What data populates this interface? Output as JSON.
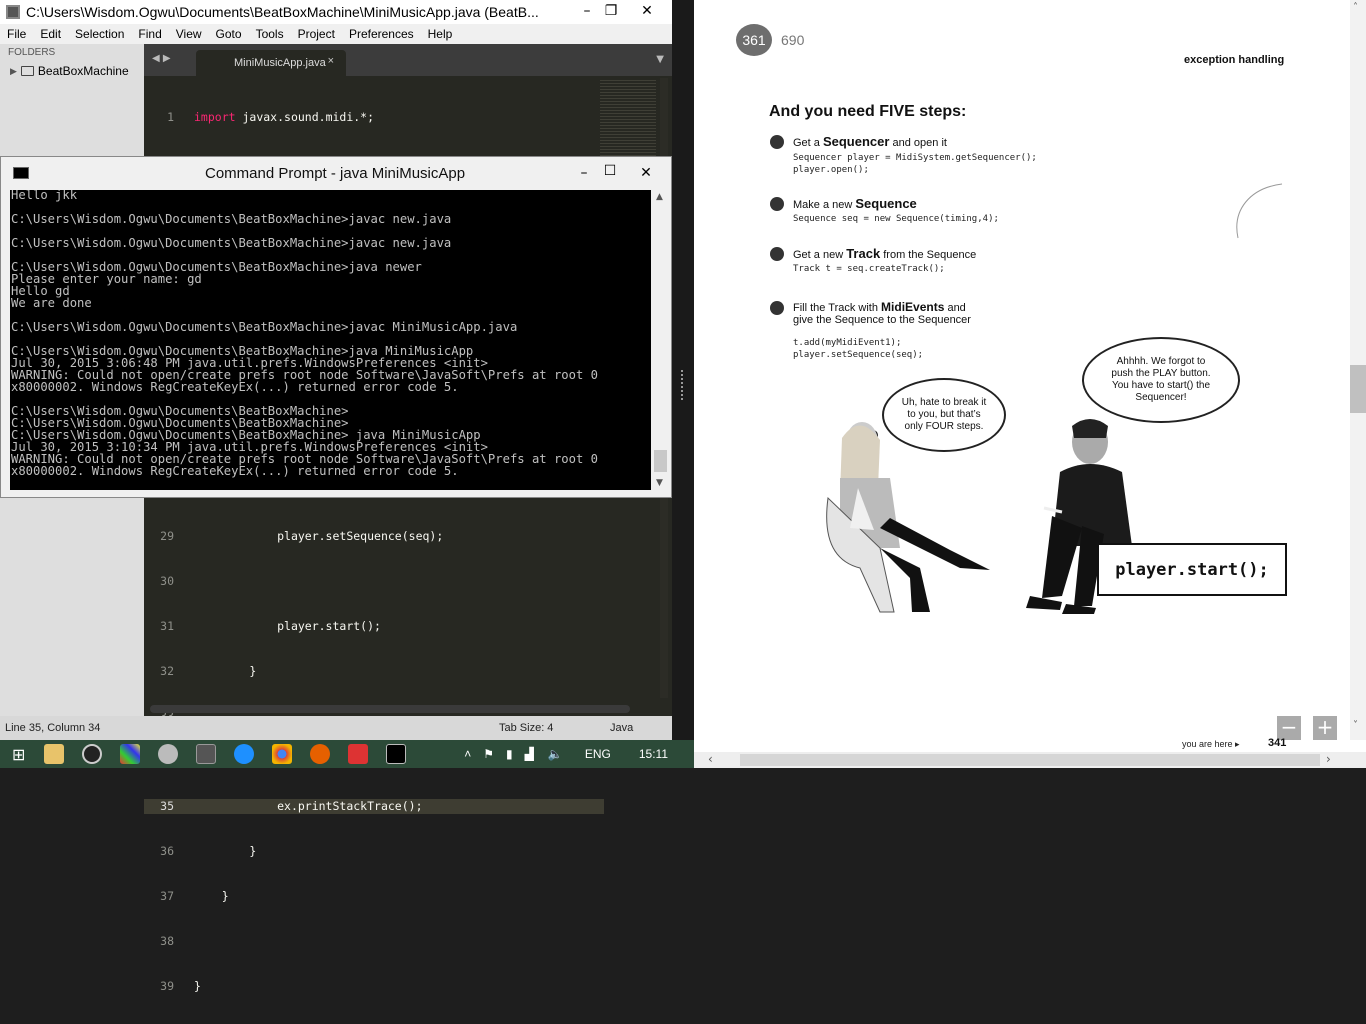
{
  "editor": {
    "title": "C:\\Users\\Wisdom.Ogwu\\Documents\\BeatBoxMachine\\MiniMusicApp.java (BeatB...",
    "menu": [
      "File",
      "Edit",
      "Selection",
      "Find",
      "View",
      "Goto",
      "Tools",
      "Project",
      "Preferences",
      "Help"
    ],
    "sidebar": {
      "header": "FOLDERS",
      "folder": "BeatBoxMachine"
    },
    "tab": "MiniMusicApp.java",
    "status": {
      "position": "Line 35, Column 34",
      "tab_size": "Tab Size: 4",
      "syntax": "Java"
    }
  },
  "cmd": {
    "title": "Command Prompt - java  MiniMusicApp",
    "lines": [
      "Hello jkk",
      "",
      "C:\\Users\\Wisdom.Ogwu\\Documents\\BeatBoxMachine>javac new.java",
      "",
      "C:\\Users\\Wisdom.Ogwu\\Documents\\BeatBoxMachine>javac new.java",
      "",
      "C:\\Users\\Wisdom.Ogwu\\Documents\\BeatBoxMachine>java newer",
      "Please enter your name: gd",
      "Hello gd",
      "We are done",
      "",
      "C:\\Users\\Wisdom.Ogwu\\Documents\\BeatBoxMachine>javac MiniMusicApp.java",
      "",
      "C:\\Users\\Wisdom.Ogwu\\Documents\\BeatBoxMachine>java MiniMusicApp",
      "Jul 30, 2015 3:06:48 PM java.util.prefs.WindowsPreferences <init>",
      "WARNING: Could not open/create prefs root node Software\\JavaSoft\\Prefs at root 0",
      "x80000002. Windows RegCreateKeyEx(...) returned error code 5.",
      "",
      "C:\\Users\\Wisdom.Ogwu\\Documents\\BeatBoxMachine>",
      "C:\\Users\\Wisdom.Ogwu\\Documents\\BeatBoxMachine>",
      "C:\\Users\\Wisdom.Ogwu\\Documents\\BeatBoxMachine> java MiniMusicApp",
      "Jul 30, 2015 3:10:34 PM java.util.prefs.WindowsPreferences <init>",
      "WARNING: Could not open/create prefs root node Software\\JavaSoft\\Prefs at root 0",
      "x80000002. Windows RegCreateKeyEx(...) returned error code 5."
    ]
  },
  "reader": {
    "page": "361",
    "total": "690",
    "header": "exception handling",
    "heading": "And you need FIVE steps:",
    "steps": [
      {
        "pre": "Get a ",
        "bold": "Sequencer",
        "post": " and open it",
        "code": "Sequencer player = MidiSystem.getSequencer();\nplayer.open();"
      },
      {
        "pre": "Make a new ",
        "bold": "Sequence",
        "post": "",
        "code": "Sequence seq = new Sequence(timing,4);"
      },
      {
        "pre": "Get a new ",
        "bold": "Track",
        "post": " from the Sequence",
        "code": "Track t = seq.createTrack();"
      },
      {
        "pre": "Fill the Track with ",
        "bold": "MidiEvents",
        "post": " and",
        "line2": "give the Sequence to the Sequencer",
        "code": "t.add(myMidiEvent1);\nplayer.setSequence(seq);"
      }
    ],
    "bubble_left": "Uh, hate to break it to you, but that’s only FOUR steps.",
    "bubble_right": "Ahhhh. We forgot to push the PLAY button. You have to start() the Sequencer!",
    "code_box": "player.start();",
    "footer": "you are here ▸",
    "footer_page": "341"
  },
  "taskbar": {
    "lang": "ENG",
    "time": "15:11"
  }
}
